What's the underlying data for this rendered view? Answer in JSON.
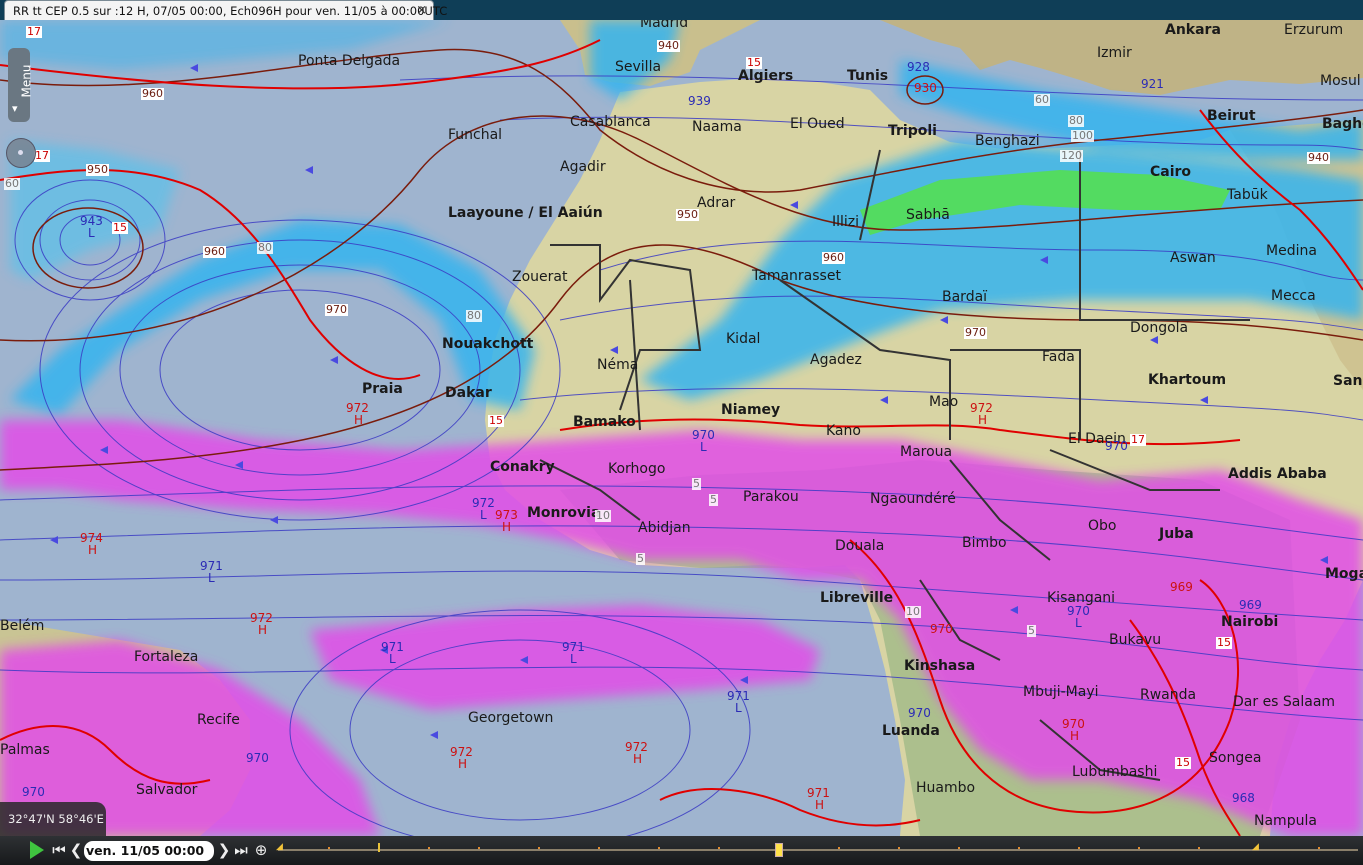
{
  "window": {
    "tab_title": "RR tt CEP 0.5 sur :12 H, 07/05 00:00, Ech096H pour ven. 11/05 à 00:00UTC",
    "close_glyph": "×"
  },
  "menu": {
    "label": "Menu",
    "icon": "chevron-down-icon"
  },
  "coords": "32°47'N 58°46'E",
  "controls": {
    "play_icon": "play-icon",
    "first_glyph": "⏮",
    "prev_glyph": "❮",
    "next_glyph": "❯",
    "last_glyph": "⏭",
    "zoom_glyph": "⊕",
    "date_value": "ven. 11/05 00:00",
    "timeline_position": 0.46
  },
  "colors": {
    "ocean": "#9fb4cf",
    "land": "#d8d4a4",
    "precip_cyan": "#35b4ef",
    "precip_green": "#55e04a",
    "precip_magenta": "#e24ee8",
    "isobar_blue": "#3a3ac4",
    "isotherm_red": "#e00000",
    "height_brown": "#7a1c0c"
  },
  "places": [
    {
      "name": "Ponta Delgada",
      "bold": false
    },
    {
      "name": "Funchal",
      "bold": false
    },
    {
      "name": "Madrid",
      "bold": false
    },
    {
      "name": "Sevilla",
      "bold": false
    },
    {
      "name": "Casablanca",
      "bold": false
    },
    {
      "name": "Algiers",
      "bold": true
    },
    {
      "name": "Tunis",
      "bold": true
    },
    {
      "name": "Naama",
      "bold": false
    },
    {
      "name": "El Oued",
      "bold": false
    },
    {
      "name": "Tripoli",
      "bold": true
    },
    {
      "name": "Benghazi",
      "bold": false
    },
    {
      "name": "Agadir",
      "bold": false
    },
    {
      "name": "Laayoune / El Aaiún",
      "bold": true
    },
    {
      "name": "Adrar",
      "bold": false
    },
    {
      "name": "Illizi",
      "bold": false
    },
    {
      "name": "Sabhā",
      "bold": false
    },
    {
      "name": "Cairo",
      "bold": true
    },
    {
      "name": "Tabūk",
      "bold": false
    },
    {
      "name": "Zouerat",
      "bold": false
    },
    {
      "name": "Tamanrasset",
      "bold": false
    },
    {
      "name": "Aswan",
      "bold": false
    },
    {
      "name": "Medina",
      "bold": false
    },
    {
      "name": "Bardaï",
      "bold": false
    },
    {
      "name": "Mecca",
      "bold": false
    },
    {
      "name": "Nouakchott",
      "bold": true
    },
    {
      "name": "Kidal",
      "bold": false
    },
    {
      "name": "Dongola",
      "bold": false
    },
    {
      "name": "Néma",
      "bold": false
    },
    {
      "name": "Agadez",
      "bold": false
    },
    {
      "name": "Fada",
      "bold": false
    },
    {
      "name": "Praia",
      "bold": true
    },
    {
      "name": "Dakar",
      "bold": true
    },
    {
      "name": "Khartoum",
      "bold": true
    },
    {
      "name": "Bamako",
      "bold": true
    },
    {
      "name": "Niamey",
      "bold": true
    },
    {
      "name": "Mao",
      "bold": false
    },
    {
      "name": "Kano",
      "bold": false
    },
    {
      "name": "El Daein",
      "bold": false
    },
    {
      "name": "Maroua",
      "bold": false
    },
    {
      "name": "Addis Ababa",
      "bold": true
    },
    {
      "name": "Conakry",
      "bold": true
    },
    {
      "name": "Korhogo",
      "bold": false
    },
    {
      "name": "Parakou",
      "bold": false
    },
    {
      "name": "Ngaoundéré",
      "bold": false
    },
    {
      "name": "Monrovia",
      "bold": true
    },
    {
      "name": "Abidjan",
      "bold": false
    },
    {
      "name": "Douala",
      "bold": false
    },
    {
      "name": "Bimbo",
      "bold": false
    },
    {
      "name": "Obo",
      "bold": false
    },
    {
      "name": "Juba",
      "bold": true
    },
    {
      "name": "Libreville",
      "bold": true
    },
    {
      "name": "Kisangani",
      "bold": false
    },
    {
      "name": "Nairobi",
      "bold": true
    },
    {
      "name": "Belém",
      "bold": false
    },
    {
      "name": "Fortaleza",
      "bold": false
    },
    {
      "name": "Bukavu",
      "bold": false
    },
    {
      "name": "Kinshasa",
      "bold": true
    },
    {
      "name": "Recife",
      "bold": false
    },
    {
      "name": "Mbuji-Mayi",
      "bold": false
    },
    {
      "name": "Rwanda",
      "bold": false
    },
    {
      "name": "Dar es Salaam",
      "bold": false
    },
    {
      "name": "Georgetown",
      "bold": false
    },
    {
      "name": "Luanda",
      "bold": true
    },
    {
      "name": "Palmas",
      "bold": false
    },
    {
      "name": "Lubumbashi",
      "bold": false
    },
    {
      "name": "Songea",
      "bold": false
    },
    {
      "name": "Salvador",
      "bold": false
    },
    {
      "name": "Huambo",
      "bold": false
    },
    {
      "name": "Nampula",
      "bold": false
    },
    {
      "name": "Ankara",
      "bold": true
    },
    {
      "name": "Erzurum",
      "bold": false
    },
    {
      "name": "Izmir",
      "bold": false
    },
    {
      "name": "Beirut",
      "bold": true
    },
    {
      "name": "Baghdad",
      "bold": true
    },
    {
      "name": "Sana'a",
      "bold": true
    },
    {
      "name": "Mogadishu",
      "bold": true
    },
    {
      "name": "Mosul",
      "bold": false
    }
  ],
  "pressure_labels": [
    {
      "value": "943",
      "type": "L"
    },
    {
      "value": "939",
      "type": "L"
    },
    {
      "value": "928",
      "type": "L"
    },
    {
      "value": "930",
      "type": "H"
    },
    {
      "value": "921",
      "type": "L"
    },
    {
      "value": "970",
      "type": "L"
    },
    {
      "value": "972",
      "type": "H"
    },
    {
      "value": "972",
      "type": "H"
    },
    {
      "value": "970",
      "type": "L"
    },
    {
      "value": "972",
      "type": "L"
    },
    {
      "value": "973",
      "type": "H"
    },
    {
      "value": "974",
      "type": "H"
    },
    {
      "value": "971",
      "type": "L"
    },
    {
      "value": "972",
      "type": "H"
    },
    {
      "value": "971",
      "type": "L"
    },
    {
      "value": "971",
      "type": "L"
    },
    {
      "value": "971",
      "type": "L"
    },
    {
      "value": "972",
      "type": "H"
    },
    {
      "value": "972",
      "type": "H"
    },
    {
      "value": "971",
      "type": "H"
    },
    {
      "value": "970",
      "type": "L"
    },
    {
      "value": "970",
      "type": "H"
    },
    {
      "value": "970",
      "type": "L"
    },
    {
      "value": "969",
      "type": "L"
    },
    {
      "value": "970",
      "type": "H"
    },
    {
      "value": "970",
      "type": "L"
    },
    {
      "value": "968",
      "type": "L"
    },
    {
      "value": "969",
      "type": "L"
    },
    {
      "value": "970",
      "type": "L"
    }
  ],
  "contour_tags": [
    "17",
    "950",
    "940",
    "960",
    "960",
    "950",
    "970",
    "970",
    "80",
    "80",
    "80",
    "60",
    "60",
    "100",
    "120",
    "940",
    "17",
    "15",
    "15",
    "15",
    "15",
    "15",
    "10",
    "10",
    "5",
    "5",
    "5",
    "5",
    "960",
    "17"
  ]
}
